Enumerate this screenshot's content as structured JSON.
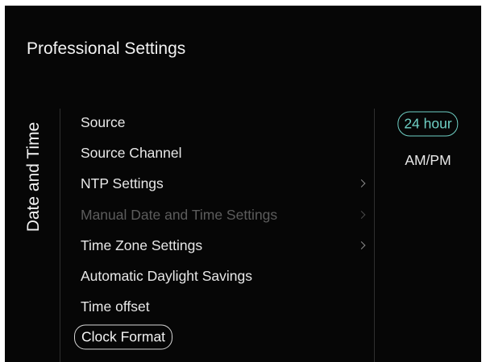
{
  "header": {
    "title": "Professional Settings"
  },
  "section": {
    "label": "Date and Time"
  },
  "menu": {
    "items": [
      {
        "label": "Source",
        "has_submenu": false,
        "enabled": true,
        "selected": false
      },
      {
        "label": "Source Channel",
        "has_submenu": false,
        "enabled": true,
        "selected": false
      },
      {
        "label": "NTP Settings",
        "has_submenu": true,
        "enabled": true,
        "selected": false
      },
      {
        "label": "Manual Date and Time Settings",
        "has_submenu": true,
        "enabled": false,
        "selected": false
      },
      {
        "label": "Time Zone Settings",
        "has_submenu": true,
        "enabled": true,
        "selected": false
      },
      {
        "label": "Automatic Daylight Savings",
        "has_submenu": false,
        "enabled": true,
        "selected": false
      },
      {
        "label": "Time offset",
        "has_submenu": false,
        "enabled": true,
        "selected": false
      },
      {
        "label": "Clock Format",
        "has_submenu": false,
        "enabled": true,
        "selected": true
      }
    ]
  },
  "options": {
    "items": [
      {
        "label": "24 hour",
        "active": true
      },
      {
        "label": "AM/PM",
        "active": false
      }
    ]
  },
  "colors": {
    "background": "#060606",
    "accent": "#6fd0c5",
    "text": "#e8e8e8",
    "disabled_text": "#5c5c5c",
    "divider": "#2f2f2f"
  }
}
